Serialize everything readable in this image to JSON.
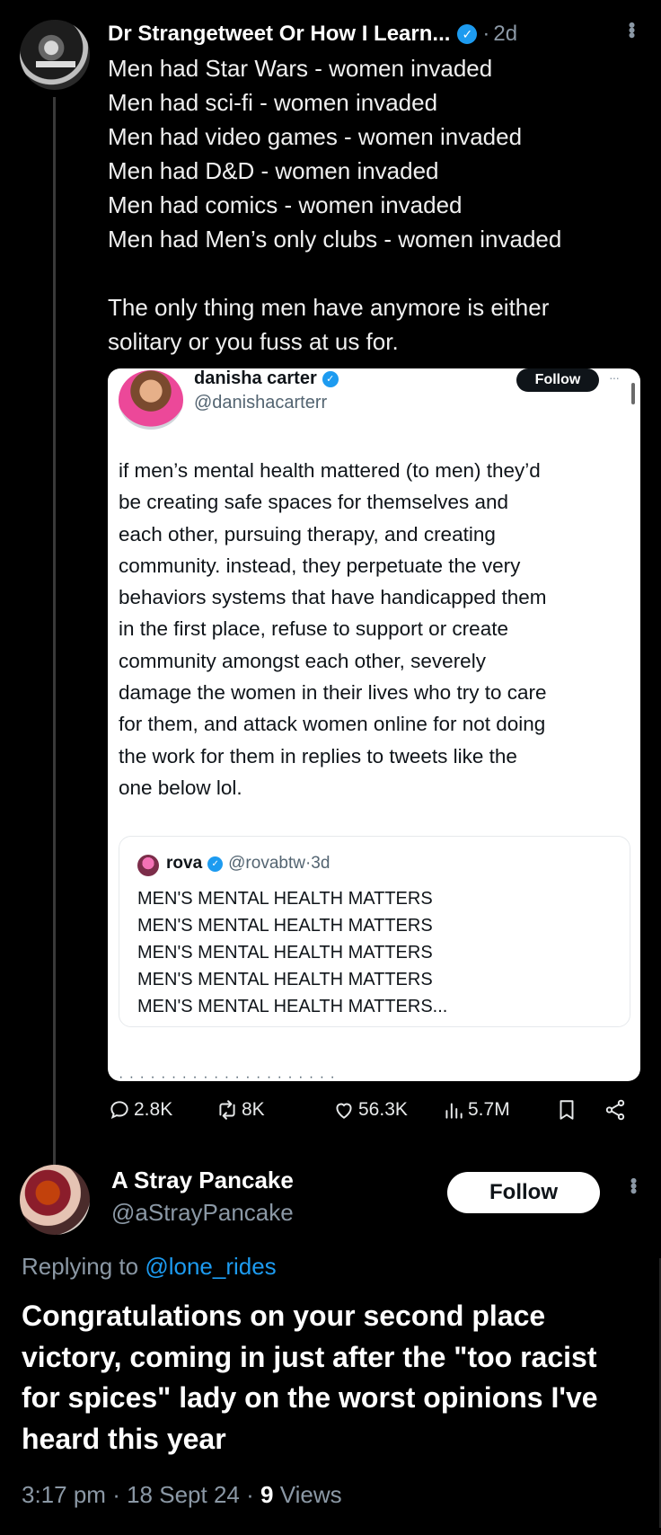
{
  "tweet": {
    "author_name": "Dr Strangetweet Or How I Learn...",
    "separator": "·",
    "time": "2d",
    "more_icon": "more-vertical-icon",
    "body_lines_1": [
      "Men had Star Wars - women invaded",
      "Men had sci-fi - women invaded",
      "Men had video games - women invaded",
      "Men had D&D - women invaded",
      "Men had comics - women invaded",
      "Men had Men’s only clubs - women invaded"
    ],
    "body_lines_2": [
      "The only thing men have anymore is either",
      "solitary or you fuss at us for."
    ]
  },
  "embedded": {
    "name": "danisha carter",
    "handle": "@danishacarterr",
    "follow_label": "Follow",
    "more_label": "···",
    "text_lines": [
      "if men’s mental health mattered (to men) they’d",
      "be creating safe spaces for themselves and",
      "each other, pursuing therapy, and creating",
      "community. instead, they perpetuate the very",
      "behaviors systems that have handicapped them",
      "in the first place, refuse to support or create",
      "community amongst each other, severely",
      "damage the women in their lives who try to care",
      "for them, and attack women online for not doing",
      "the work for them in replies to tweets like the",
      "one below lol."
    ],
    "cut_text": "· · · · · · · · · · · · · · · · · · · · ·",
    "quote": {
      "name": "rova",
      "handle": "@rovabtw",
      "separator": "·",
      "time": "3d",
      "lines": [
        "MEN'S MENTAL HEALTH MATTERS",
        "MEN'S MENTAL HEALTH MATTERS",
        "MEN'S MENTAL HEALTH MATTERS",
        "MEN'S MENTAL HEALTH MATTERS",
        "MEN'S MENTAL HEALTH MATTERS..."
      ]
    }
  },
  "actions": {
    "replies": "2.8K",
    "reposts": "8K",
    "likes": "56.3K",
    "views": "5.7M"
  },
  "reply": {
    "name": "A Stray Pancake",
    "handle": "@aStrayPancake",
    "follow_label": "Follow",
    "replying_prefix": "Replying to ",
    "replying_to": "@lone_rides",
    "body_lines": [
      "Congratulations on your second place",
      "victory, coming in just after the \"too racist",
      "for spices\" lady on the worst opinions I've",
      "heard this year"
    ],
    "time": "3:17 pm",
    "date": "18 Sept 24",
    "sep": "·",
    "views_count": "9",
    "views_label": "Views"
  },
  "colors": {
    "background": "#000000",
    "accent": "#1d9bf0",
    "muted": "#8b98a5"
  }
}
